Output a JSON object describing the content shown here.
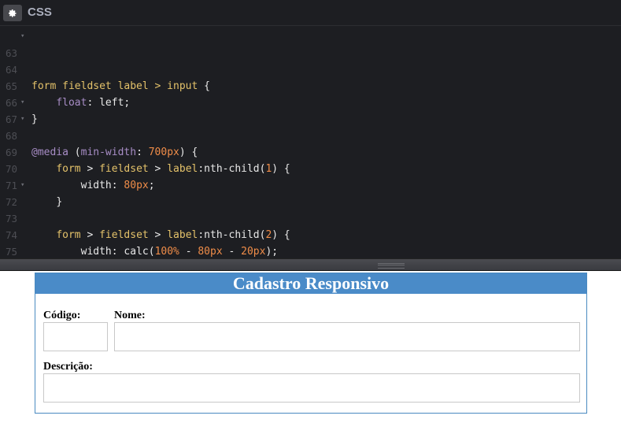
{
  "editor": {
    "title": "CSS",
    "gear_icon": "gear-icon",
    "lines": [
      {
        "n": "63",
        "fold": "▾"
      },
      {
        "n": "64",
        "fold": ""
      },
      {
        "n": "65",
        "fold": ""
      },
      {
        "n": "66",
        "fold": ""
      },
      {
        "n": "67",
        "fold": "▾"
      },
      {
        "n": "68",
        "fold": "▾"
      },
      {
        "n": "69",
        "fold": ""
      },
      {
        "n": "70",
        "fold": ""
      },
      {
        "n": "71",
        "fold": ""
      },
      {
        "n": "72",
        "fold": "▾"
      },
      {
        "n": "73",
        "fold": ""
      },
      {
        "n": "74",
        "fold": ""
      },
      {
        "n": "75",
        "fold": ""
      }
    ],
    "code": {
      "l63": {
        "selector": "form fieldset label > input",
        "brace": " {"
      },
      "l64": {
        "prop": "float",
        "colon": ": ",
        "value": "left",
        "semi": ";"
      },
      "l65": {
        "brace": "}"
      },
      "l67": {
        "at": "@media",
        "open": " (",
        "feature": "min-width",
        "colon": ": ",
        "num": "700px",
        "close": ") {"
      },
      "l68": {
        "s1": "form",
        "g1": " > ",
        "s2": "fieldset",
        "g2": " > ",
        "s3": "label",
        "pc": ":nth-child(",
        "n": "1",
        "end": ") {"
      },
      "l69": {
        "prop": "width",
        "colon": ": ",
        "num": "80px",
        "semi": ";"
      },
      "l70": {
        "brace": "}"
      },
      "l72": {
        "s1": "form",
        "g1": " > ",
        "s2": "fieldset",
        "g2": " > ",
        "s3": "label",
        "pc": ":nth-child(",
        "n": "2",
        "end": ") {"
      },
      "l73": {
        "prop": "width",
        "colon": ": ",
        "fn": "calc(",
        "a": "100%",
        "m1": " - ",
        "b": "80px",
        "m2": " - ",
        "c": "20px",
        "end": ");"
      },
      "l74": {
        "brace": "}"
      },
      "l75": {
        "brace": "}"
      }
    }
  },
  "preview": {
    "title": "Cadastro Responsivo",
    "fields": {
      "codigo_label": "Código:",
      "codigo_value": "",
      "nome_label": "Nome:",
      "nome_value": "",
      "descricao_label": "Descrição:",
      "descricao_value": ""
    }
  },
  "colors": {
    "editor_bg": "#1d1e22",
    "header_bar": "#4a8bc8",
    "selector": "#e4c26a",
    "property": "#a88dc6",
    "number": "#f08d49"
  }
}
